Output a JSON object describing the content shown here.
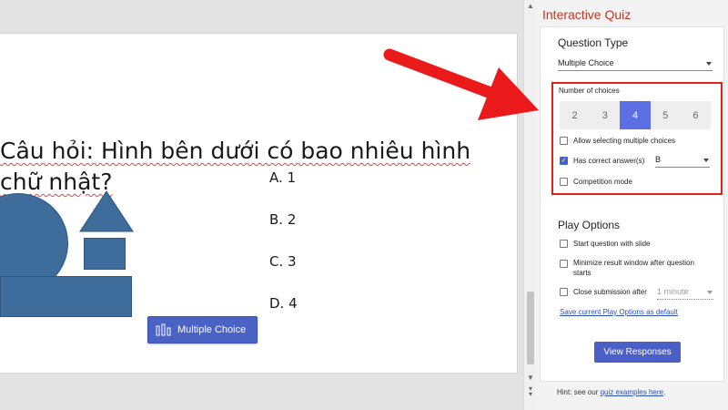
{
  "slide": {
    "question": "Câu hỏi: Hình bên dưới có bao nhiêu hình chữ nhật?",
    "question_line1": "Câu hỏi: Hình bên dưới có bao nhiêu hình",
    "question_line2": "chữ nhật?",
    "options": [
      "A. 1",
      "B. 2",
      "C. 3",
      "D. 4"
    ],
    "badge_label": "Multiple Choice",
    "shapes": [
      "circle",
      "triangle",
      "square",
      "rectangle"
    ],
    "shape_color": "#3f6d9b"
  },
  "panel": {
    "title": "Interactive Quiz",
    "title_color": "#c1361e",
    "question_type": {
      "heading": "Question Type",
      "selected": "Multiple Choice"
    },
    "number_of_choices": {
      "label": "Number of choices",
      "options": [
        "2",
        "3",
        "4",
        "5",
        "6"
      ],
      "selected": "4"
    },
    "checks": {
      "allow_multiple": {
        "label": "Allow selecting multiple choices",
        "checked": false
      },
      "has_correct": {
        "label": "Has correct answer(s)",
        "checked": true,
        "answer": "B"
      },
      "competition": {
        "label": "Competition mode",
        "checked": false
      }
    },
    "play_options": {
      "heading": "Play Options",
      "start_with_slide": {
        "label": "Start question with slide",
        "checked": false
      },
      "minimize_line1": "Minimize result window after question",
      "minimize_line2": "starts",
      "close_submission": {
        "label": "Close submission after",
        "checked": false,
        "value": "1 minute"
      },
      "save_link": "Save current Play Options as default"
    },
    "view_button": "View Responses",
    "hint_prefix": "Hint: see our ",
    "hint_link": "quiz examples here",
    "hint_suffix": "."
  },
  "colors": {
    "accent": "#5b6ee2",
    "button": "#4a5fc8",
    "highlight": "#e0201d",
    "arrow": "#ea1a1a"
  }
}
